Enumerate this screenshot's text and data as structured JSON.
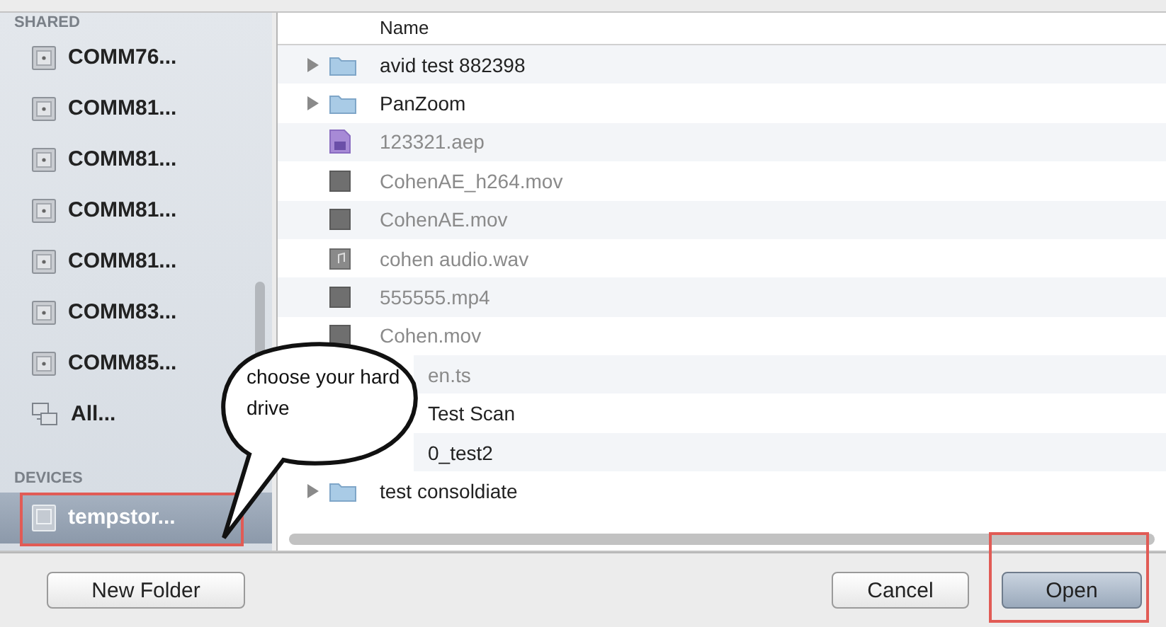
{
  "sidebar": {
    "sections": [
      {
        "title": "SHARED",
        "items": [
          {
            "label": "COMM76...",
            "kind": "server",
            "selected": false,
            "highlighted": false
          },
          {
            "label": "COMM81...",
            "kind": "server",
            "selected": false,
            "highlighted": false
          },
          {
            "label": "COMM81...",
            "kind": "server",
            "selected": false,
            "highlighted": false
          },
          {
            "label": "COMM81...",
            "kind": "server",
            "selected": false,
            "highlighted": false
          },
          {
            "label": "COMM81...",
            "kind": "server",
            "selected": false,
            "highlighted": false
          },
          {
            "label": "COMM83...",
            "kind": "server",
            "selected": false,
            "highlighted": false
          },
          {
            "label": "COMM85...",
            "kind": "server",
            "selected": false,
            "highlighted": false
          },
          {
            "label": "All...",
            "kind": "network",
            "selected": false,
            "highlighted": false
          }
        ]
      },
      {
        "title": "DEVICES",
        "items": [
          {
            "label": "tempstor...",
            "kind": "drive",
            "selected": true,
            "highlighted": true
          }
        ]
      }
    ]
  },
  "file_list": {
    "columns": [
      "Name"
    ],
    "rows": [
      {
        "name": "avid test 882398",
        "kind": "folder",
        "disabled": false,
        "covered": false
      },
      {
        "name": "PanZoom",
        "kind": "folder",
        "disabled": false,
        "covered": false
      },
      {
        "name": "123321.aep",
        "kind": "project",
        "disabled": true,
        "covered": false
      },
      {
        "name": "CohenAE_h264.mov",
        "kind": "movie",
        "disabled": true,
        "covered": false
      },
      {
        "name": "CohenAE.mov",
        "kind": "movie",
        "disabled": true,
        "covered": false
      },
      {
        "name": "cohen audio.wav",
        "kind": "audio",
        "disabled": true,
        "covered": false
      },
      {
        "name": "555555.mp4",
        "kind": "movie",
        "disabled": true,
        "covered": false
      },
      {
        "name": "Cohen.mov",
        "kind": "movie",
        "disabled": true,
        "covered": false
      },
      {
        "name": "en.ts",
        "kind": "movie",
        "disabled": true,
        "covered": true
      },
      {
        "name": "Test Scan",
        "kind": "folder",
        "disabled": false,
        "covered": true
      },
      {
        "name": "0_test2",
        "kind": "folder",
        "disabled": false,
        "covered": true
      },
      {
        "name": "test consoldiate",
        "kind": "folder",
        "disabled": false,
        "covered": false
      }
    ]
  },
  "callout": {
    "text": "choose your hard drive"
  },
  "buttons": [
    {
      "label": "New Folder",
      "default": false,
      "highlighted": false
    },
    {
      "label": "Cancel",
      "default": false,
      "highlighted": false
    },
    {
      "label": "Open",
      "default": true,
      "highlighted": true
    }
  ]
}
